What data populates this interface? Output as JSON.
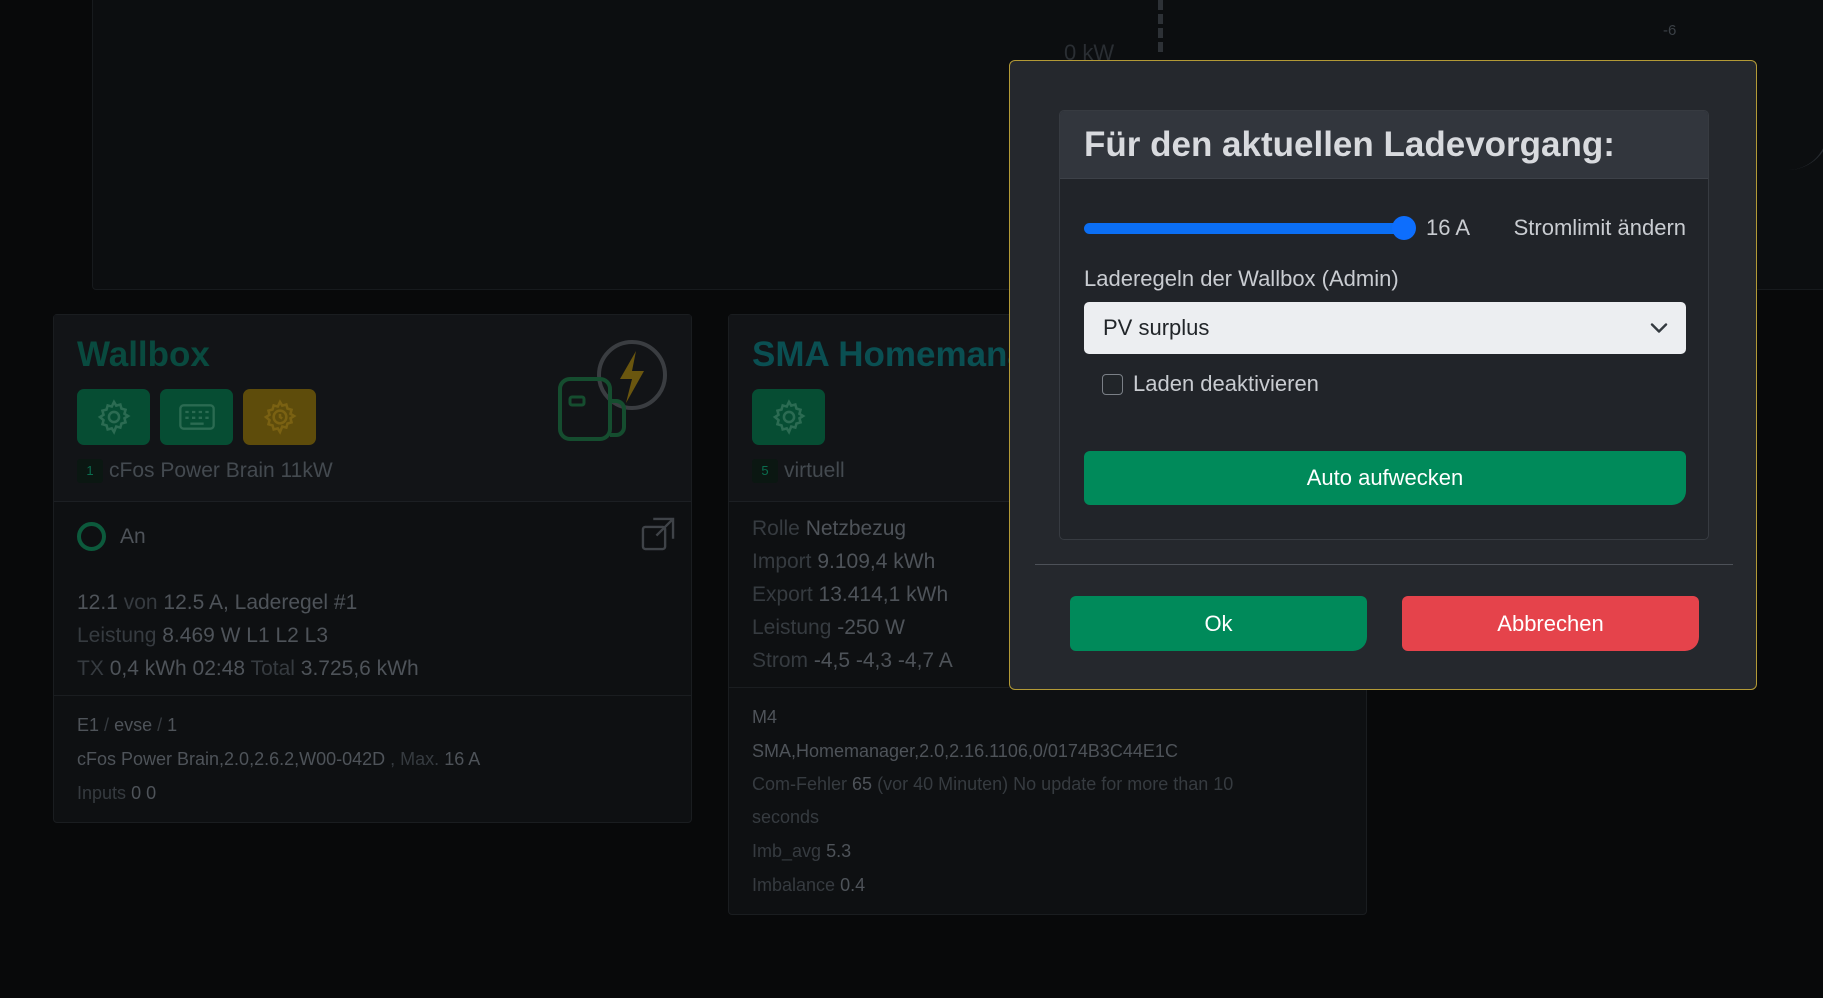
{
  "chart": {
    "tick_label": "-6",
    "fragment_text": "0 kW"
  },
  "wallbox": {
    "title": "Wallbox",
    "index": "1",
    "model": "cFos Power Brain 11kW",
    "status": "An",
    "current_value": "12.1",
    "current_of": "von",
    "current_limit": "12.5 A, Laderegel #1",
    "power_label": "Leistung",
    "power_value": "8.469 W L1 L2 L3",
    "tx_label": "TX",
    "tx_value": "0,4 kWh 02:48",
    "total_label": "Total",
    "total_value": "3.725,6 kWh",
    "path_a": "E1",
    "path_sep1": "/",
    "path_b": "evse",
    "path_sep2": "/",
    "path_c": "1",
    "firmware": "cFos Power Brain,2.0,2.6.2,W00-042D",
    "max_label": ", Max.",
    "max_value": "16 A",
    "inputs_label": "Inputs",
    "inputs_value": "0 0"
  },
  "sma": {
    "title": "SMA Homemanager",
    "index": "5",
    "type": "virtuell",
    "role_label": "Rolle",
    "role_value": "Netzbezug",
    "import_label": "Import",
    "import_value": "9.109,4 kWh",
    "export_label": "Export",
    "export_value": "13.414,1 kWh",
    "power_label": "Leistung",
    "power_value": "-250 W",
    "current_label": "Strom",
    "current_value": "-4,5 -4,3 -4,7 A",
    "meter_id": "M4",
    "firmware": "SMA,Homemanager,2.0,2.16.1106,0/0174B3C44E1C",
    "com_error_label": "Com-Fehler",
    "com_error_count": "65",
    "com_error_time": "(vor 40 Minuten)",
    "com_error_msg": "No update for more than 10 seconds",
    "imb_avg_label": "Imb_avg",
    "imb_avg_value": "5.3",
    "imbalance_label": "Imbalance",
    "imbalance_value": "0.4"
  },
  "modal": {
    "heading": "Für den aktuellen Ladevorgang:",
    "slider_level": 1.0,
    "slider_value": "16 A",
    "slider_label": "Stromlimit ändern",
    "rule_label": "Laderegeln der Wallbox (Admin)",
    "rule_selected": "PV surplus",
    "disable_label": "Laden deaktivieren",
    "wake_button": "Auto aufwecken",
    "ok_button": "Ok",
    "cancel_button": "Abbrechen"
  }
}
